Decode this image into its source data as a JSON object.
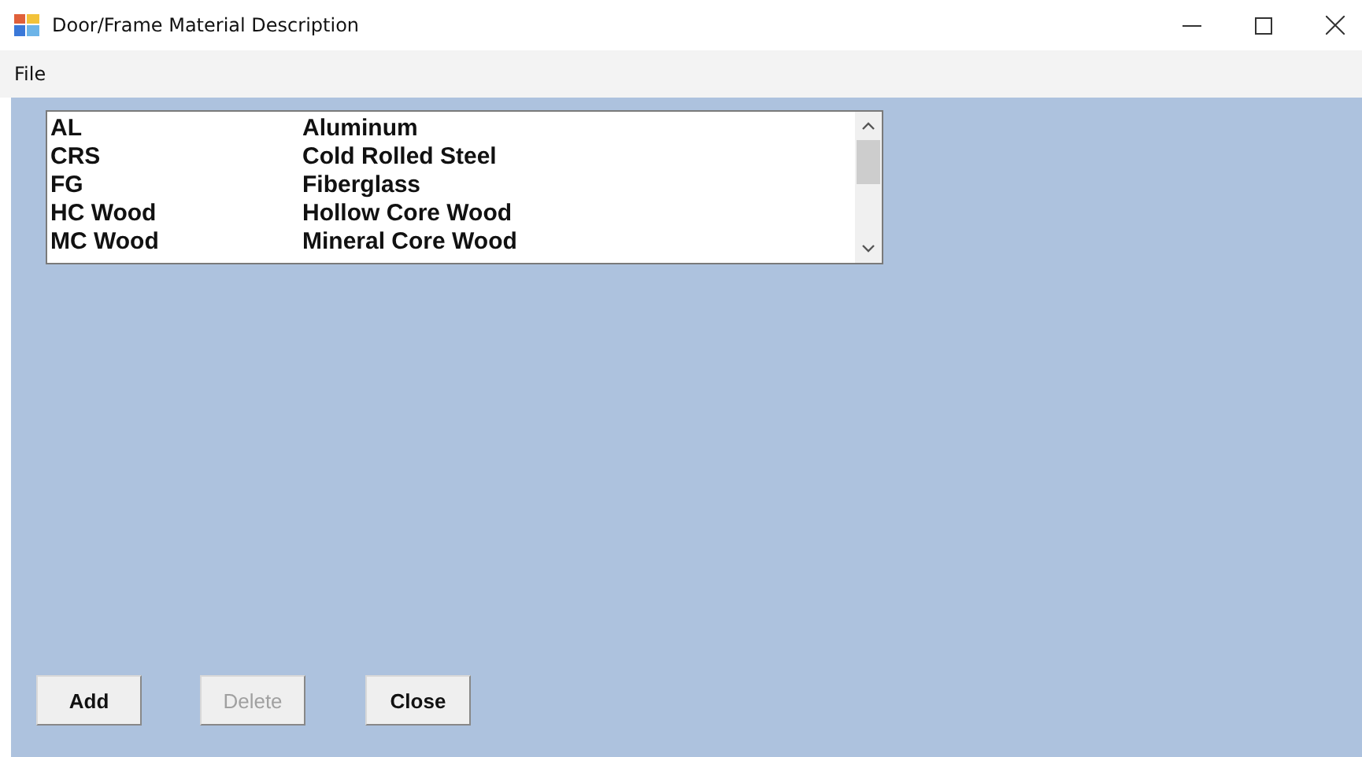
{
  "window": {
    "title": "Door/Frame Material Description"
  },
  "menu": [
    {
      "label": "File"
    }
  ],
  "list": {
    "rows": [
      {
        "code": "AL",
        "description": "Aluminum"
      },
      {
        "code": "CRS",
        "description": "Cold Rolled Steel"
      },
      {
        "code": "FG",
        "description": "Fiberglass"
      },
      {
        "code": "HC Wood",
        "description": "Hollow Core Wood"
      },
      {
        "code": "MC Wood",
        "description": "Mineral Core Wood"
      }
    ]
  },
  "buttons": [
    {
      "label": "Add",
      "disabled": false
    },
    {
      "label": "Delete",
      "disabled": true
    },
    {
      "label": "Close",
      "disabled": false
    }
  ]
}
